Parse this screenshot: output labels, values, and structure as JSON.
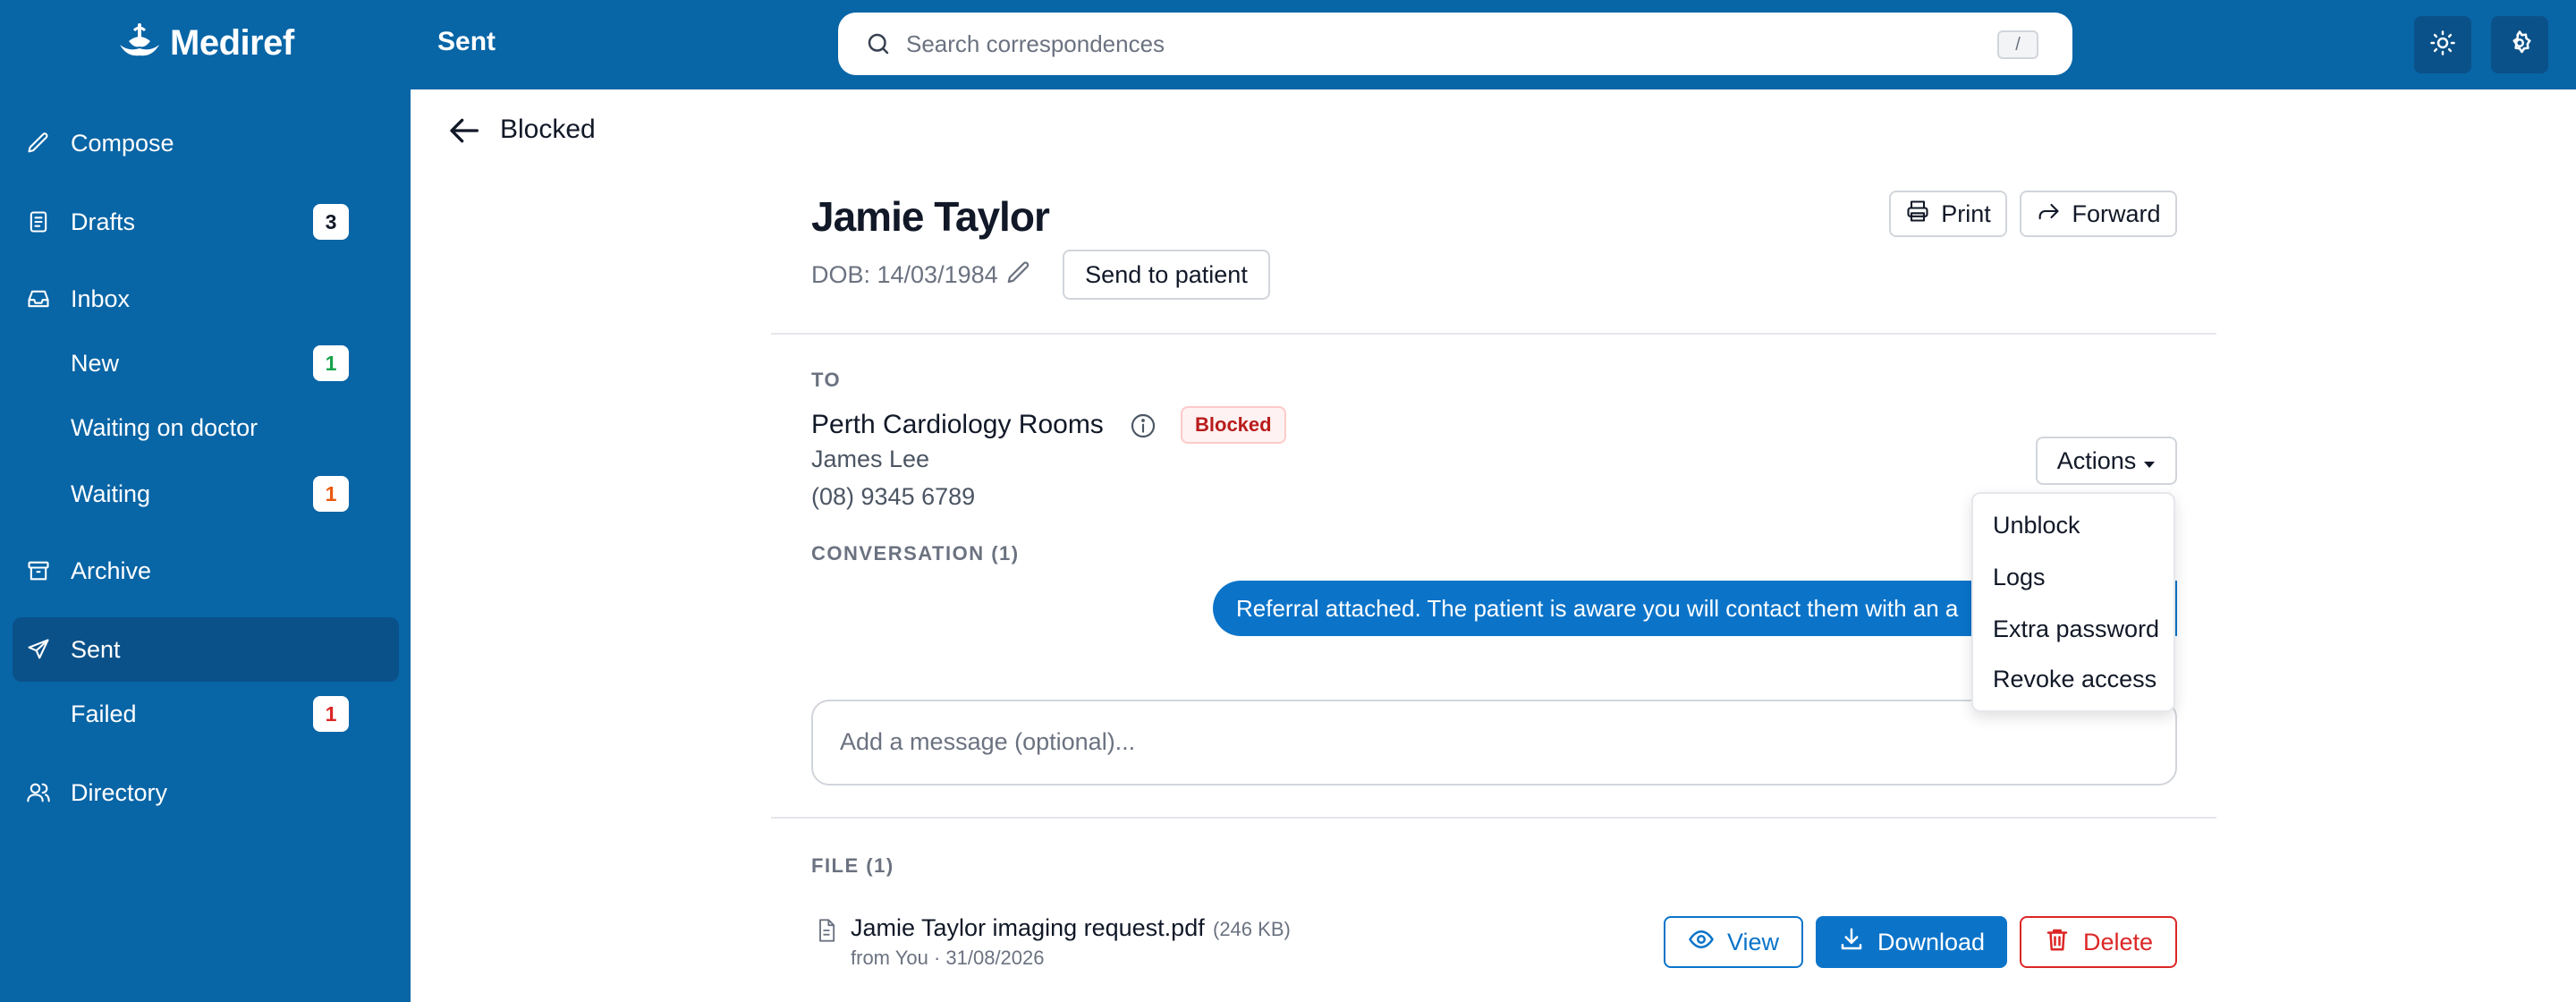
{
  "app": {
    "name": "Mediref"
  },
  "sidebar": {
    "items": [
      {
        "label": "Compose",
        "icon": "pencil-icon"
      },
      {
        "label": "Drafts",
        "icon": "drafts-icon",
        "badge": "3"
      },
      {
        "label": "Inbox",
        "icon": "inbox-icon"
      },
      {
        "label": "New",
        "badge": "1"
      },
      {
        "label": "Waiting on doctor"
      },
      {
        "label": "Waiting",
        "badge": "1"
      },
      {
        "label": "Archive",
        "icon": "archive-icon"
      },
      {
        "label": "Sent",
        "icon": "send-icon",
        "active": true
      },
      {
        "label": "Failed",
        "badge": "1"
      },
      {
        "label": "Directory",
        "icon": "users-icon"
      }
    ]
  },
  "header": {
    "title": "Sent",
    "search_placeholder": "Search correspondences",
    "search_shortcut": "/"
  },
  "back": {
    "label": "Blocked"
  },
  "patient": {
    "name": "Jamie Taylor",
    "dob": "DOB: 14/03/1984",
    "send_to_patient": "Send to patient"
  },
  "toolbar": {
    "print": "Print",
    "forward": "Forward"
  },
  "to": {
    "section_label": "TO",
    "recipient": "Perth Cardiology Rooms",
    "status": "Blocked",
    "contact_name": "James Lee",
    "phone": "(08) 9345 6789"
  },
  "actions": {
    "label": "Actions",
    "menu": [
      "Unblock",
      "Logs",
      "Extra password",
      "Revoke access"
    ]
  },
  "conversation": {
    "section_label": "CONVERSATION (1)",
    "message": "Referral attached. The patient is aware you will contact them with an a"
  },
  "compose": {
    "placeholder": "Add a message (optional)..."
  },
  "file": {
    "section_label": "FILE (1)",
    "name": "Jamie Taylor imaging request.pdf",
    "size": "(246 KB)",
    "meta": "from You · 31/08/2026",
    "view": "View",
    "download": "Download",
    "delete": "Delete"
  },
  "colors": {
    "brand": "#0865a6",
    "primary": "#0b74c9",
    "danger": "#dc2626",
    "badge_success": "#16a34a",
    "badge_warning": "#ea580c",
    "badge_danger": "#dc2626"
  }
}
